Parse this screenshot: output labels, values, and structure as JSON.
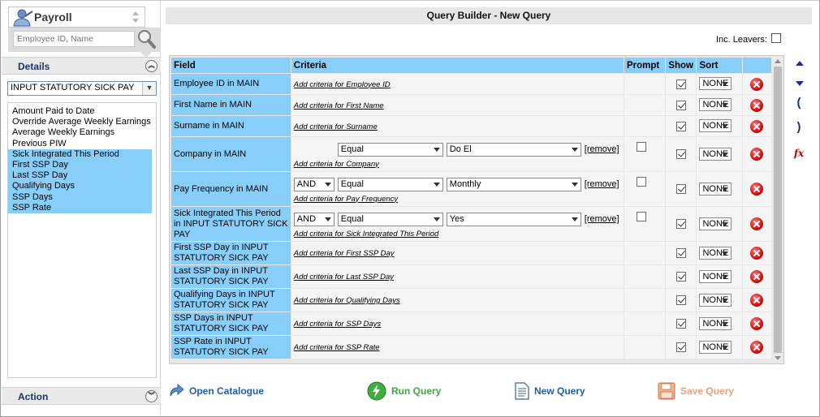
{
  "sidebar": {
    "module": "Payroll",
    "search_placeholder": "Employee ID, Name",
    "details_label": "Details",
    "category": "INPUT STATUTORY SICK PAY",
    "fields": [
      {
        "label": "Amount Paid to Date",
        "selected": false
      },
      {
        "label": "Override Average Weekly Earnings",
        "selected": false
      },
      {
        "label": "Average Weekly Earnings",
        "selected": false
      },
      {
        "label": "Previous PIW",
        "selected": false
      },
      {
        "label": "Sick Integrated This Period",
        "selected": true
      },
      {
        "label": "First SSP Day",
        "selected": true
      },
      {
        "label": "Last SSP Day",
        "selected": true
      },
      {
        "label": "Qualifying Days",
        "selected": true
      },
      {
        "label": "SSP Days",
        "selected": true
      },
      {
        "label": "SSP Rate",
        "selected": true
      }
    ],
    "action_label": "Action"
  },
  "header": {
    "title": "Query Builder - New Query",
    "inc_leavers_label": "Inc. Leavers:"
  },
  "grid": {
    "columns": [
      "Field",
      "Criteria",
      "Prompt",
      "Show",
      "Sort",
      ""
    ],
    "rows": [
      {
        "field": "Employee ID in MAIN",
        "add": "Add criteria for Employee ID",
        "sort": "NONE",
        "show": true
      },
      {
        "field": "First Name in MAIN",
        "add": "Add criteria for First Name",
        "sort": "NONE",
        "show": true
      },
      {
        "field": "Surname in MAIN",
        "add": "Add criteria for Surname",
        "sort": "NONE",
        "show": true
      },
      {
        "field": "Company in MAIN",
        "add": "Add criteria for Company",
        "sort": "NONE",
        "show": true,
        "criteria": {
          "conj": "",
          "op": "Equal",
          "value": "Do El",
          "remove": "[remove]"
        }
      },
      {
        "field": "Pay Frequency in MAIN",
        "add": "Add criteria for Pay Frequency",
        "sort": "NONE",
        "show": true,
        "criteria": {
          "conj": "AND",
          "op": "Equal",
          "value": "Monthly",
          "remove": "[remove]"
        }
      },
      {
        "field": "Sick Integrated This Period in INPUT STATUTORY SICK PAY",
        "add": "Add criteria for Sick Integrated This Period",
        "sort": "NONE",
        "show": true,
        "criteria": {
          "conj": "AND",
          "op": "Equal",
          "value": "Yes",
          "remove": "[remove]"
        }
      },
      {
        "field": "First SSP Day in INPUT STATUTORY SICK PAY",
        "add": "Add criteria for First SSP Day",
        "sort": "NONE",
        "show": true
      },
      {
        "field": "Last SSP Day in INPUT STATUTORY SICK PAY",
        "add": "Add criteria for Last SSP Day",
        "sort": "NONE",
        "show": true
      },
      {
        "field": "Qualifying Days in INPUT STATUTORY SICK PAY",
        "add": "Add criteria for Qualifying Days",
        "sort": "NONE",
        "show": true
      },
      {
        "field": "SSP Days in INPUT STATUTORY SICK PAY",
        "add": "Add criteria for SSP Days",
        "sort": "NONE",
        "show": true
      },
      {
        "field": "SSP Rate in INPUT STATUTORY SICK PAY",
        "add": "Add criteria for SSP Rate",
        "sort": "NONE",
        "show": true
      }
    ]
  },
  "tools": {
    "open_paren": "(",
    "close_paren": ")",
    "fx": "fx"
  },
  "actions": {
    "open_catalogue": "Open Catalogue",
    "run_query": "Run Query",
    "new_query": "New Query",
    "save_query": "Save Query"
  },
  "colors": {
    "accent_blue": "#87cefa",
    "title_navy": "#1f3369",
    "link_blue": "#1f5fa8",
    "run_green": "#3ea83e",
    "save_orange": "#e8a07a"
  }
}
